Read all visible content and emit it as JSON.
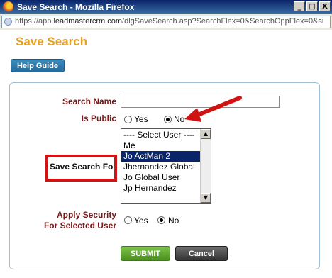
{
  "window": {
    "title": "Save Search - Mozilla Firefox",
    "minimize": "_",
    "maximize": "□",
    "close": "X"
  },
  "urlbar": {
    "prefix": "https://app.",
    "domain": "leadmastercrm.com",
    "path": "/dlgSaveSearch.asp?SearchFlex=0&SearchOppFlex=0&si"
  },
  "page": {
    "title": "Save Search",
    "help_button": "Help Guide"
  },
  "form": {
    "search_name_label": "Search Name",
    "search_name_value": "",
    "is_public_label": "Is Public",
    "is_public_yes": "Yes",
    "is_public_no": "No",
    "is_public_selected": "No",
    "save_for_label": "Save Search For",
    "save_for_options": [
      "---- Select User ----",
      "Me",
      "Jo ActMan 2",
      "Jhernandez Global",
      "Jo Global User",
      "Jp Hernandez"
    ],
    "save_for_selected": "Jo ActMan 2",
    "apply_security_label_1": "Apply Security",
    "apply_security_label_2": "For Selected User",
    "apply_security_yes": "Yes",
    "apply_security_no": "No",
    "apply_security_selected": "No",
    "submit": "SUBMIT",
    "cancel": "Cancel"
  },
  "colors": {
    "title": "#e8a020",
    "label": "#7a1818",
    "annotation": "#d01414"
  }
}
